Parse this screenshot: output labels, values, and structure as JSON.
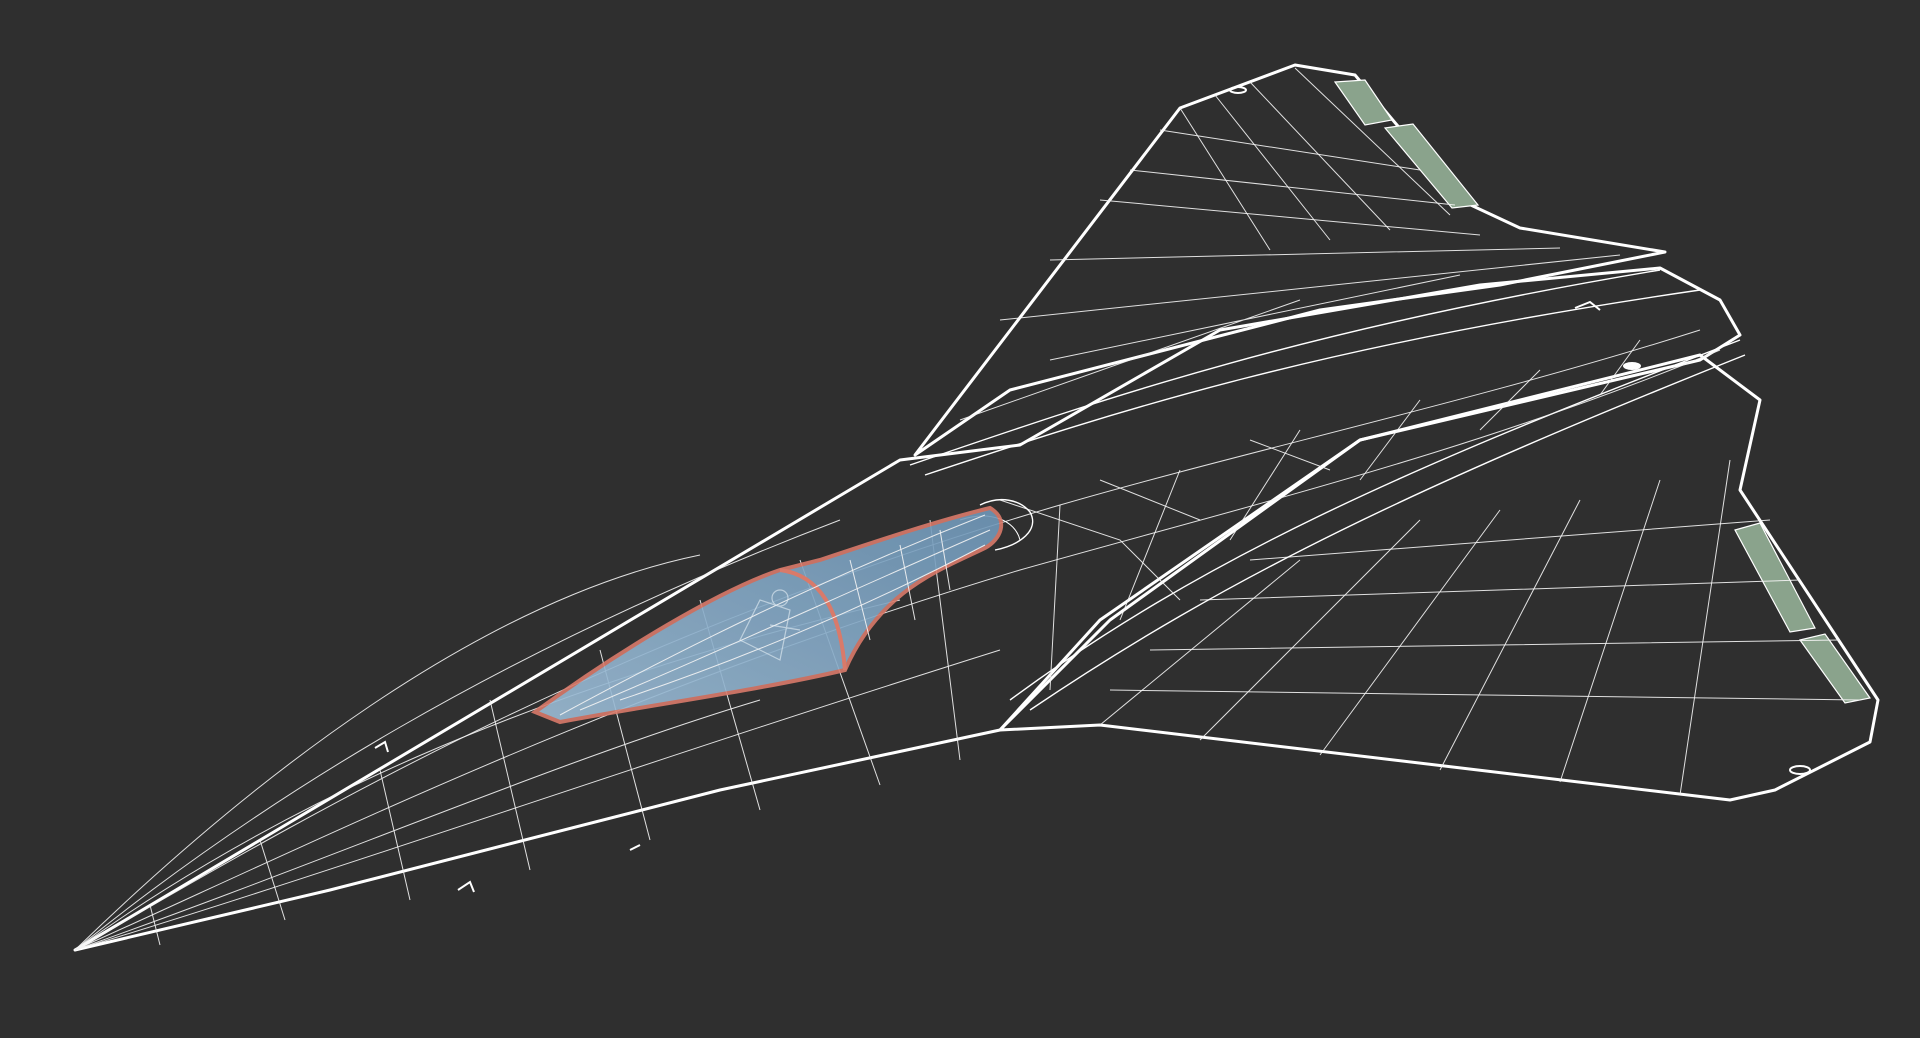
{
  "scene": {
    "background_color": "#2f2f2f",
    "subject": "aircraft-wireframe-render",
    "colors": {
      "surface": "#7e7e7e",
      "surface_light": "#8c8c8c",
      "surface_dark": "#6f6f6f",
      "wireframe": "#ffffff",
      "canopy_glass": "#7fa6c4",
      "canopy_frame": "#d97a6a",
      "control_surface": "#8aa38c"
    }
  }
}
